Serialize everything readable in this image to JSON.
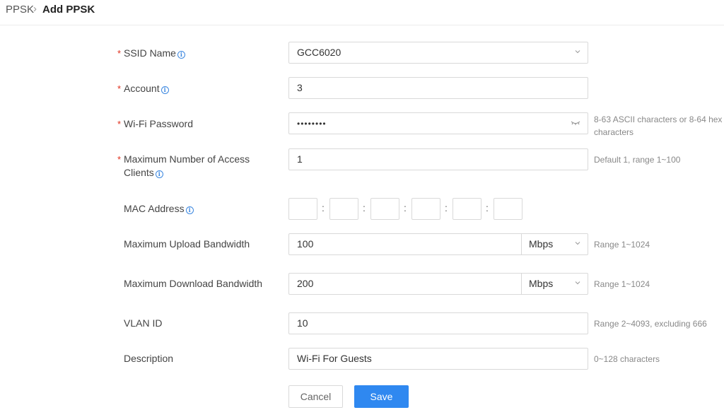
{
  "breadcrumb": {
    "root": "PPSK",
    "separator": "›",
    "current": "Add PPSK"
  },
  "form": {
    "ssid": {
      "label": "SSID Name",
      "required": true,
      "value": "GCC6020"
    },
    "account": {
      "label": "Account",
      "required": true,
      "value": "3"
    },
    "password": {
      "label": "Wi-Fi Password",
      "required": true,
      "value": "••••••••",
      "help_line1": "8-63 ASCII characters or 8-64 hex",
      "help_line2": "characters"
    },
    "max_clients": {
      "label_line1": "Maximum Number of Access",
      "label_line2": "Clients",
      "required": true,
      "value": "1",
      "help": "Default 1, range 1~100"
    },
    "mac": {
      "label": "MAC Address",
      "separator": ":"
    },
    "upload": {
      "label": "Maximum Upload Bandwidth",
      "value": "100",
      "unit": "Mbps",
      "help": "Range 1~1024"
    },
    "download": {
      "label": "Maximum Download Bandwidth",
      "value": "200",
      "unit": "Mbps",
      "help": "Range 1~1024"
    },
    "vlan": {
      "label": "VLAN ID",
      "value": "10",
      "help": "Range 2~4093, excluding 666"
    },
    "description": {
      "label": "Description",
      "value": "Wi-Fi For Guests",
      "help": "0~128 characters"
    }
  },
  "buttons": {
    "cancel": "Cancel",
    "save": "Save"
  },
  "icons": {
    "info": "info-icon",
    "dropdown": "chevron-down-icon",
    "password_toggle": "eye-closed-icon"
  },
  "colors": {
    "primary": "#2f88f0",
    "required": "#e0301e",
    "info": "#3b87e0"
  }
}
